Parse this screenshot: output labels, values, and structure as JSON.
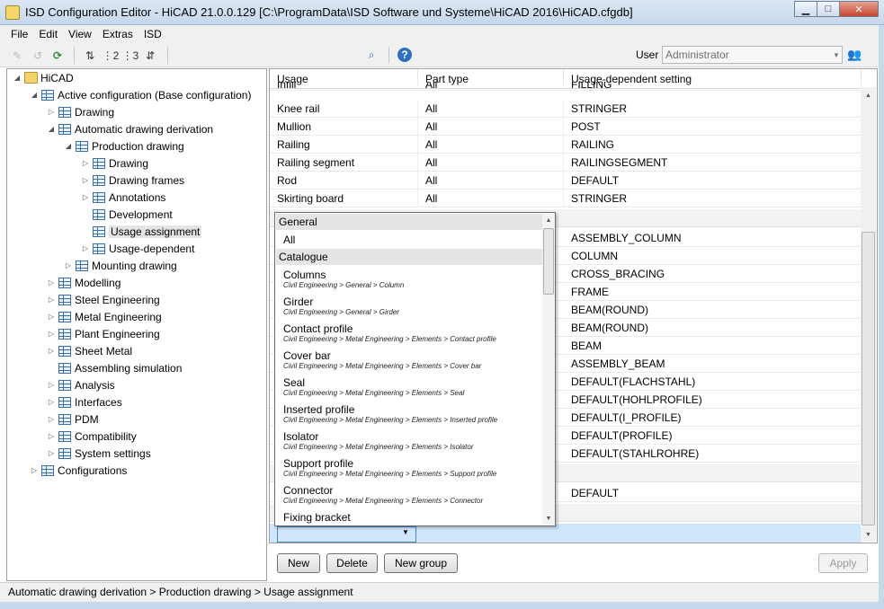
{
  "window": {
    "title": "ISD Configuration Editor - HiCAD 21.0.0.129 [C:\\ProgramData\\ISD Software und Systeme\\HiCAD 2016\\HiCAD.cfgdb]",
    "minimize": "▁",
    "maximize": "□",
    "close": "✕"
  },
  "menu": [
    "File",
    "Edit",
    "View",
    "Extras",
    "ISD"
  ],
  "toolbar": {
    "user_label": "User",
    "user_value": "Administrator"
  },
  "tree": {
    "root": "HiCAD",
    "active_config": "Active configuration (Base configuration)",
    "drawing": "Drawing",
    "auto_drawing": "Automatic drawing derivation",
    "production_drawing": "Production drawing",
    "pd_drawing": "Drawing",
    "drawing_frames": "Drawing frames",
    "annotations": "Annotations",
    "development": "Development",
    "usage_assignment": "Usage assignment",
    "usage_dependent": "Usage-dependent",
    "mounting_drawing": "Mounting drawing",
    "modelling": "Modelling",
    "steel": "Steel Engineering",
    "metal": "Metal Engineering",
    "plant": "Plant Engineering",
    "sheet": "Sheet Metal",
    "assembling": "Assembling simulation",
    "analysis": "Analysis",
    "interfaces": "Interfaces",
    "pdm": "PDM",
    "compatibility": "Compatibility",
    "system_settings": "System settings",
    "configurations": "Configurations"
  },
  "grid": {
    "columns": [
      "Usage",
      "Part type",
      "Usage-dependent setting"
    ],
    "top_rows": [
      [
        "Infill",
        "All",
        "FILLING"
      ],
      [
        "Knee rail",
        "All",
        "STRINGER"
      ],
      [
        "Mullion",
        "All",
        "POST"
      ],
      [
        "Railing",
        "All",
        "RAILING"
      ],
      [
        "Railing segment",
        "All",
        "RAILINGSEGMENT"
      ],
      [
        "Rod",
        "All",
        "DEFAULT"
      ],
      [
        "Skirting board",
        "All",
        "STRINGER"
      ]
    ],
    "settings": [
      "ASSEMBLY_COLUMN",
      "COLUMN",
      "CROSS_BRACING",
      "FRAME",
      "BEAM(ROUND)",
      "BEAM(ROUND)",
      "BEAM",
      "ASSEMBLY_BEAM",
      "DEFAULT(FLACHSTAHL)",
      "DEFAULT(HOHLPROFILE)",
      "DEFAULT(I_PROFILE)",
      "DEFAULT(PROFILE)",
      "DEFAULT(STAHLROHRE)"
    ],
    "last_setting": "DEFAULT"
  },
  "dropdown": {
    "group_general": "General",
    "all": "All",
    "group_catalogue": "Catalogue",
    "items": [
      {
        "name": "Columns",
        "path": "Civil Engineering > General > Column"
      },
      {
        "name": "Girder",
        "path": "Civil Engineering > General > Girder"
      },
      {
        "name": "Contact profile",
        "path": "Civil Engineering > Metal Engineering > Elements > Contact profile"
      },
      {
        "name": "Cover bar",
        "path": "Civil Engineering > Metal Engineering > Elements > Cover bar"
      },
      {
        "name": "Seal",
        "path": "Civil Engineering > Metal Engineering > Elements > Seal"
      },
      {
        "name": "Inserted profile",
        "path": "Civil Engineering > Metal Engineering > Elements > Inserted profile"
      },
      {
        "name": "Isolator",
        "path": "Civil Engineering > Metal Engineering > Elements > Isolator"
      },
      {
        "name": "Support profile",
        "path": "Civil Engineering > Metal Engineering > Elements > Support profile"
      },
      {
        "name": "Connector",
        "path": "Civil Engineering > Metal Engineering > Elements > Connector"
      },
      {
        "name": "Fixing bracket",
        "path": ""
      }
    ]
  },
  "buttons": {
    "new": "New",
    "delete": "Delete",
    "new_group": "New group",
    "apply": "Apply"
  },
  "status": "Automatic drawing derivation > Production drawing > Usage assignment"
}
